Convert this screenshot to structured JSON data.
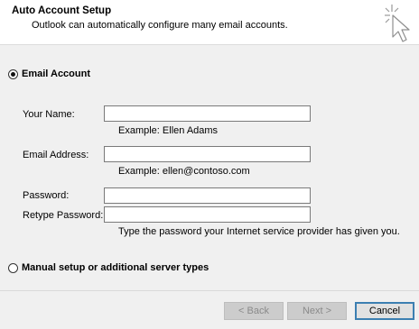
{
  "header": {
    "title": "Auto Account Setup",
    "subtitle": "Outlook can automatically configure many email accounts."
  },
  "email_account_option": {
    "label": "Email Account",
    "selected": true
  },
  "fields": {
    "your_name": {
      "label": "Your Name:",
      "value": "",
      "hint": "Example: Ellen Adams"
    },
    "email_address": {
      "label": "Email Address:",
      "value": "",
      "hint": "Example: ellen@contoso.com"
    },
    "password": {
      "label": "Password:",
      "value": ""
    },
    "retype_password": {
      "label": "Retype Password:",
      "value": "",
      "hint": "Type the password your Internet service provider has given you."
    }
  },
  "manual_option": {
    "label": "Manual setup or additional server types",
    "selected": false
  },
  "buttons": {
    "back": "< Back",
    "next": "Next >",
    "cancel": "Cancel"
  },
  "icons": {
    "wizard": "wizard-cursor-icon"
  }
}
